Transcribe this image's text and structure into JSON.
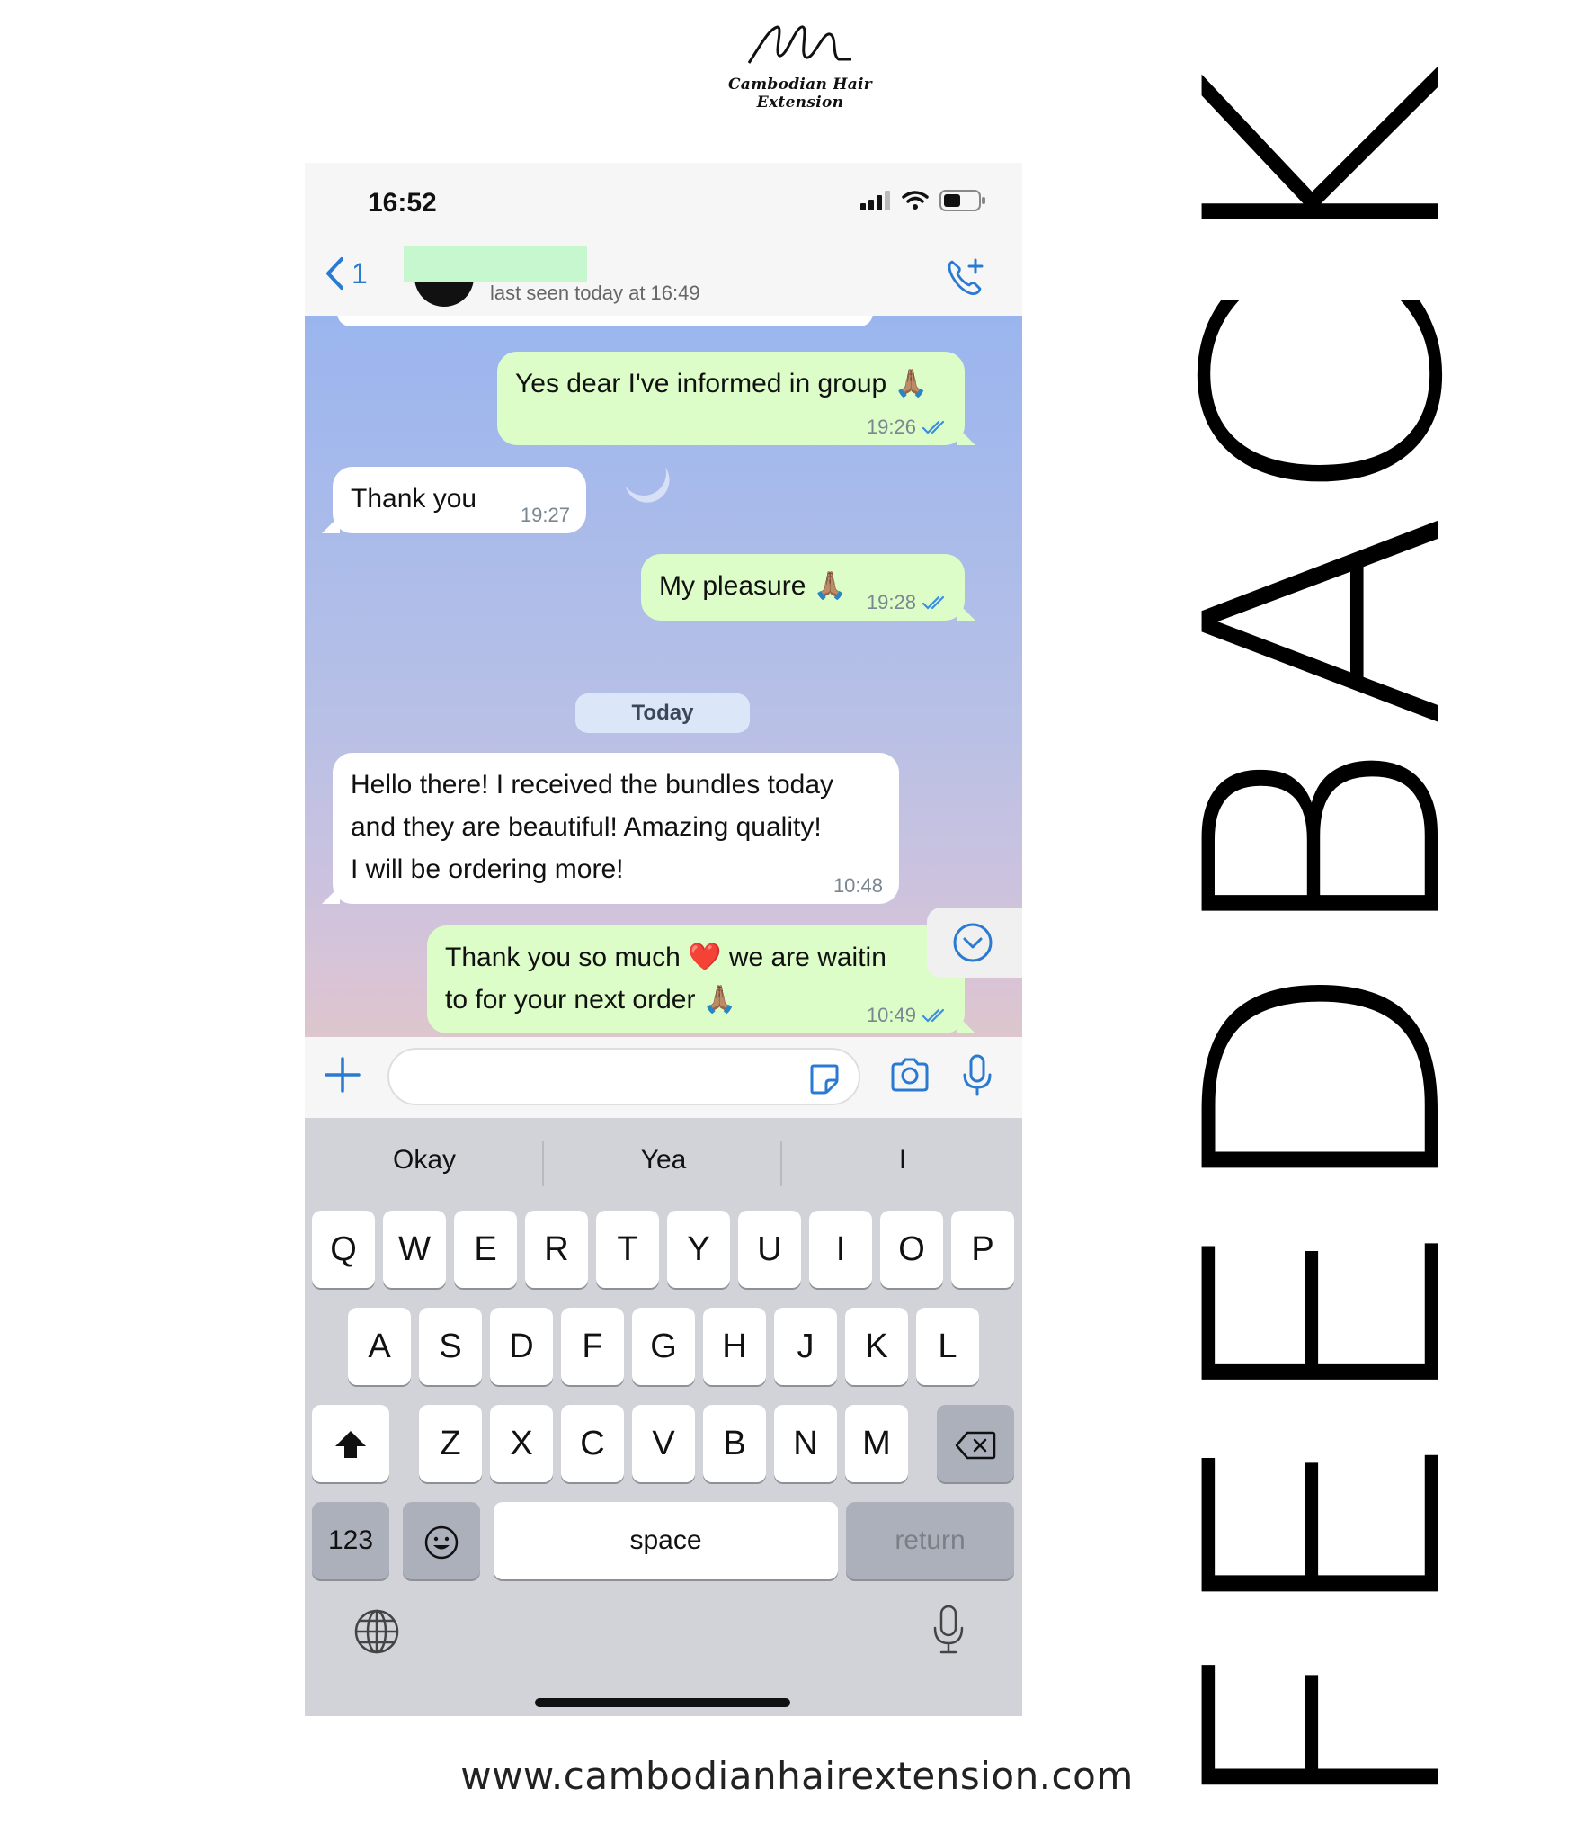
{
  "brand": {
    "logo_text": "Cambodian Hair Extension",
    "website": "www.cambodianhairextension.com",
    "side_title": "FEEDBACK"
  },
  "status_bar": {
    "time": "16:52"
  },
  "chat_header": {
    "back_count": "1",
    "last_seen": "last seen today at 16:49"
  },
  "messages": [
    {
      "direction": "out",
      "text": "Yes dear I've informed in group 🙏🏽",
      "time": "19:26"
    },
    {
      "direction": "in",
      "text": "Thank you",
      "time": "19:27"
    },
    {
      "direction": "out",
      "text": "My pleasure 🙏🏽",
      "time": "19:28"
    },
    {
      "direction": "in",
      "lines": [
        "Hello there! I received the bundles today",
        "and they are beautiful! Amazing quality!",
        "I will be ordering more!"
      ],
      "time": "10:48"
    },
    {
      "direction": "out",
      "lines": [
        "Thank you so much ❤️ we are waitin",
        "to for your next order 🙏🏽"
      ],
      "time": "10:49"
    }
  ],
  "date_separator": "Today",
  "keyboard": {
    "suggestions": [
      "Okay",
      "Yea",
      "I"
    ],
    "row1": [
      "Q",
      "W",
      "E",
      "R",
      "T",
      "Y",
      "U",
      "I",
      "O",
      "P"
    ],
    "row2": [
      "A",
      "S",
      "D",
      "F",
      "G",
      "H",
      "J",
      "K",
      "L"
    ],
    "row3": [
      "Z",
      "X",
      "C",
      "V",
      "B",
      "N",
      "M"
    ],
    "numbers_key": "123",
    "space_key": "space",
    "return_key": "return"
  },
  "colors": {
    "outgoing_bubble": "#dcfcc8",
    "incoming_bubble": "#ffffff",
    "accent": "#2a7ad1",
    "read_ticks": "#3a8ee6"
  }
}
